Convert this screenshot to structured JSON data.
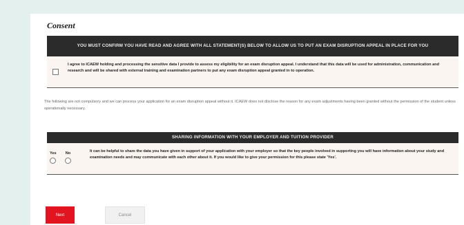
{
  "consent": {
    "title": "Consent",
    "banner_1": "YOU MUST CONFIRM YOU HAVE READ AND AGREE WITH ALL STATEMENT(S) BELOW TO ALLOW US TO PUT AN EXAM DISRUPTION APPEAL IN PLACE FOR YOU",
    "statement_1": "I agree to ICAEW holding and processing the sensitive data I provide to assess my eligibility for an exam disruption appeal. I understand that this data will be used for administration, communication and research and will be shared with external training and examination partners to put any exam disruption appeal granted in to operation.",
    "note": "The following are not compulsory and we can process your application for an exam disruption appeal without it. ICAEW does not disclose the reason for any exam adjustments having been granted without the permission of the student unless operationally necessary.",
    "banner_2": "SHARING INFORMATION WITH YOUR EMPLOYER AND TUITION PROVIDER",
    "yes_label": "Yes",
    "no_label": "No",
    "statement_2": "It can be helpful to share the data you have given in support of your application with your employer so that the key people involved in supporting you will have information about your study and examination needs and may communicate with each other about it. If you would like to give your permission for this please state 'Yes'."
  },
  "actions": {
    "next_label": "Next",
    "cancel_label": "Cancel"
  },
  "colors": {
    "page_bg": "#e3f0ee",
    "banner_bg": "#2b2b2b",
    "row_bg": "#fbf5f1",
    "primary": "#e1141f"
  }
}
